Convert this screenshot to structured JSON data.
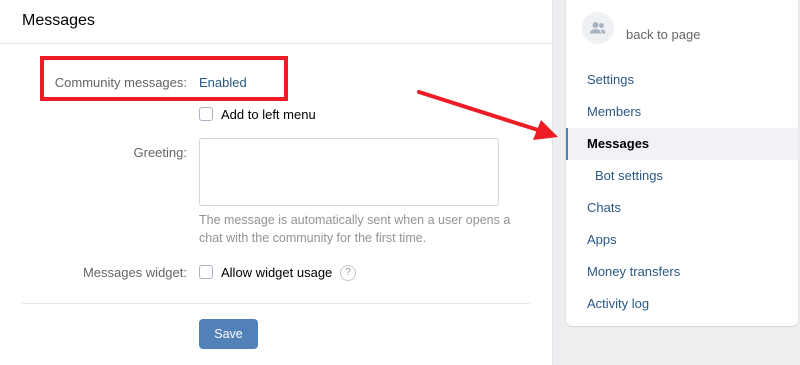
{
  "header": {
    "title": "Messages"
  },
  "form": {
    "community_messages_label": "Community messages:",
    "community_messages_value": "Enabled",
    "add_to_left_menu_label": "Add to left menu",
    "add_to_left_menu_checked": false,
    "greeting_label": "Greeting:",
    "greeting_value": "",
    "greeting_hint": "The message is automatically sent when a user opens a chat with the community for the first time.",
    "widget_label": "Messages widget:",
    "allow_widget_label": "Allow widget usage",
    "allow_widget_checked": false,
    "help_glyph": "?",
    "save_label": "Save"
  },
  "sidebar": {
    "back_label": "back to page",
    "items": [
      {
        "label": "Settings"
      },
      {
        "label": "Members"
      },
      {
        "label": "Messages",
        "active": true
      },
      {
        "label": "Bot settings",
        "sub": true
      },
      {
        "label": "Chats"
      },
      {
        "label": "Apps"
      },
      {
        "label": "Money transfers"
      },
      {
        "label": "Activity log"
      }
    ]
  },
  "colors": {
    "accent": "#5181b8",
    "link": "#2a5885",
    "annotation": "#ee1c24"
  }
}
